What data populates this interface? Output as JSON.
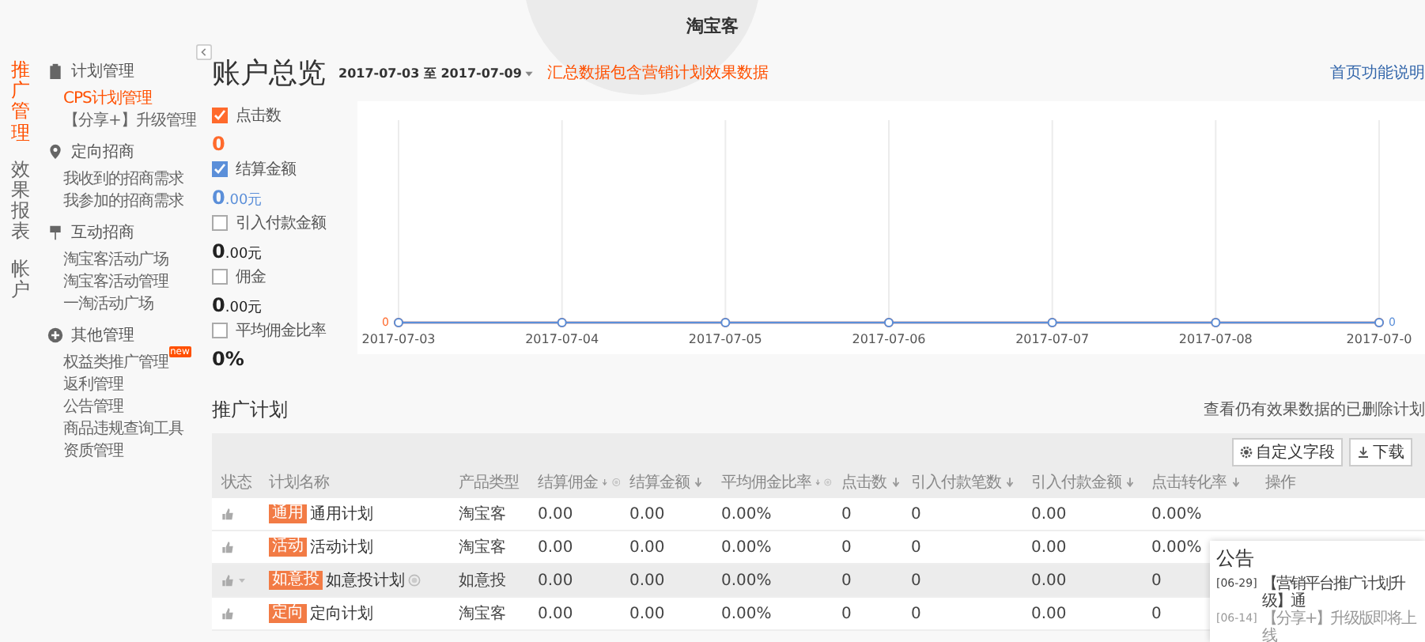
{
  "header": {
    "logo_text": "淘宝客"
  },
  "main_nav": [
    {
      "label": "推广管理",
      "selected": true
    },
    {
      "label": "效果报表",
      "selected": false
    },
    {
      "label": "帐户",
      "selected": false
    }
  ],
  "sub_nav": [
    {
      "label": "计划管理",
      "children": [
        {
          "label": "CPS计划管理",
          "selected": true
        },
        {
          "label": "【分享+】升级管理",
          "selected": false
        }
      ]
    },
    {
      "label": "定向招商",
      "children": [
        {
          "label": "我收到的招商需求",
          "selected": false
        },
        {
          "label": "我参加的招商需求",
          "selected": false
        }
      ]
    },
    {
      "label": "互动招商",
      "children": [
        {
          "label": "淘宝客活动广场",
          "selected": false
        },
        {
          "label": "淘宝客活动管理",
          "selected": false
        },
        {
          "label": "一淘活动广场",
          "selected": false
        }
      ]
    },
    {
      "label": "其他管理",
      "children": [
        {
          "label": "权益类推广管理",
          "selected": false,
          "badge": "new"
        },
        {
          "label": "返利管理",
          "selected": false
        },
        {
          "label": "公告管理",
          "selected": false
        },
        {
          "label": "商品违规查询工具",
          "selected": false
        },
        {
          "label": "资质管理",
          "selected": false
        }
      ]
    }
  ],
  "overview": {
    "title": "账户总览",
    "date_range": "2017-07-03 至 2017-07-09",
    "note": "汇总数据包含营销计划效果数据",
    "help_link": "首页功能说明"
  },
  "metrics": [
    {
      "label": "点击数",
      "checked": true,
      "color": "#ff6a2c",
      "value": "0"
    },
    {
      "label": "结算金额",
      "checked": true,
      "color": "#5b8fd9",
      "value": "0.00元"
    },
    {
      "label": "引入付款金额",
      "checked": false,
      "value": "0.00元"
    },
    {
      "label": "佣金",
      "checked": false,
      "value": "0.00元"
    },
    {
      "label": "平均佣金比率",
      "checked": false,
      "value": "0%"
    }
  ],
  "trend_chart": {
    "x_labels": [
      "2017-07-03",
      "2017-07-04",
      "2017-07-05",
      "2017-07-06",
      "2017-07-07",
      "2017-07-08",
      "2017-07-0"
    ],
    "left_label": "0",
    "right_label": "0"
  },
  "plans": {
    "title": "推广计划",
    "deleted_link": "查看仍有效果数据的已删除计划",
    "toolbar": [
      "自定义字段",
      "下载"
    ],
    "columns": [
      {
        "label": "状态",
        "sort": false,
        "help": false
      },
      {
        "label": "计划名称",
        "sort": false,
        "help": false
      },
      {
        "label": "产品类型",
        "sort": false,
        "help": false
      },
      {
        "label": "结算佣金",
        "sort": true,
        "help": true
      },
      {
        "label": "结算金额",
        "sort": true,
        "help": false
      },
      {
        "label": "平均佣金比率",
        "sort": true,
        "help": true
      },
      {
        "label": "点击数",
        "sort": true,
        "help": false
      },
      {
        "label": "引入付款笔数",
        "sort": true,
        "help": false
      },
      {
        "label": "引入付款金额",
        "sort": true,
        "help": false
      },
      {
        "label": "点击转化率",
        "sort": true,
        "help": false
      },
      {
        "label": "操作",
        "sort": false,
        "help": false
      }
    ],
    "rows": [
      {
        "tag": "通用",
        "help": false,
        "highlighted": false,
        "cells": [
          "",
          "通用计划",
          "淘宝客",
          "0.00",
          "0.00",
          "0.00%",
          "0",
          "0",
          "0.00",
          "0.00%"
        ]
      },
      {
        "tag": "活动",
        "help": false,
        "highlighted": false,
        "cells": [
          "",
          "活动计划",
          "淘宝客",
          "0.00",
          "0.00",
          "0.00%",
          "0",
          "0",
          "0.00",
          "0.00%"
        ]
      },
      {
        "tag": "如意投",
        "help": true,
        "highlighted": true,
        "cells": [
          "",
          "如意投计划",
          "如意投",
          "0.00",
          "0.00",
          "0.00%",
          "0",
          "0",
          "0.00",
          "0"
        ]
      },
      {
        "tag": "定向",
        "help": false,
        "highlighted": false,
        "cells": [
          "",
          "定向计划",
          "淘宝客",
          "0.00",
          "0.00",
          "0.00%",
          "0",
          "0",
          "0.00",
          "0"
        ]
      }
    ]
  },
  "announcements": {
    "title": "公告",
    "items": [
      {
        "date": "[06-29]",
        "text": "【营销平台推广计划升级】通"
      },
      {
        "date": "[06-14]",
        "text": "【分享+】升级版即将上线"
      }
    ]
  }
}
